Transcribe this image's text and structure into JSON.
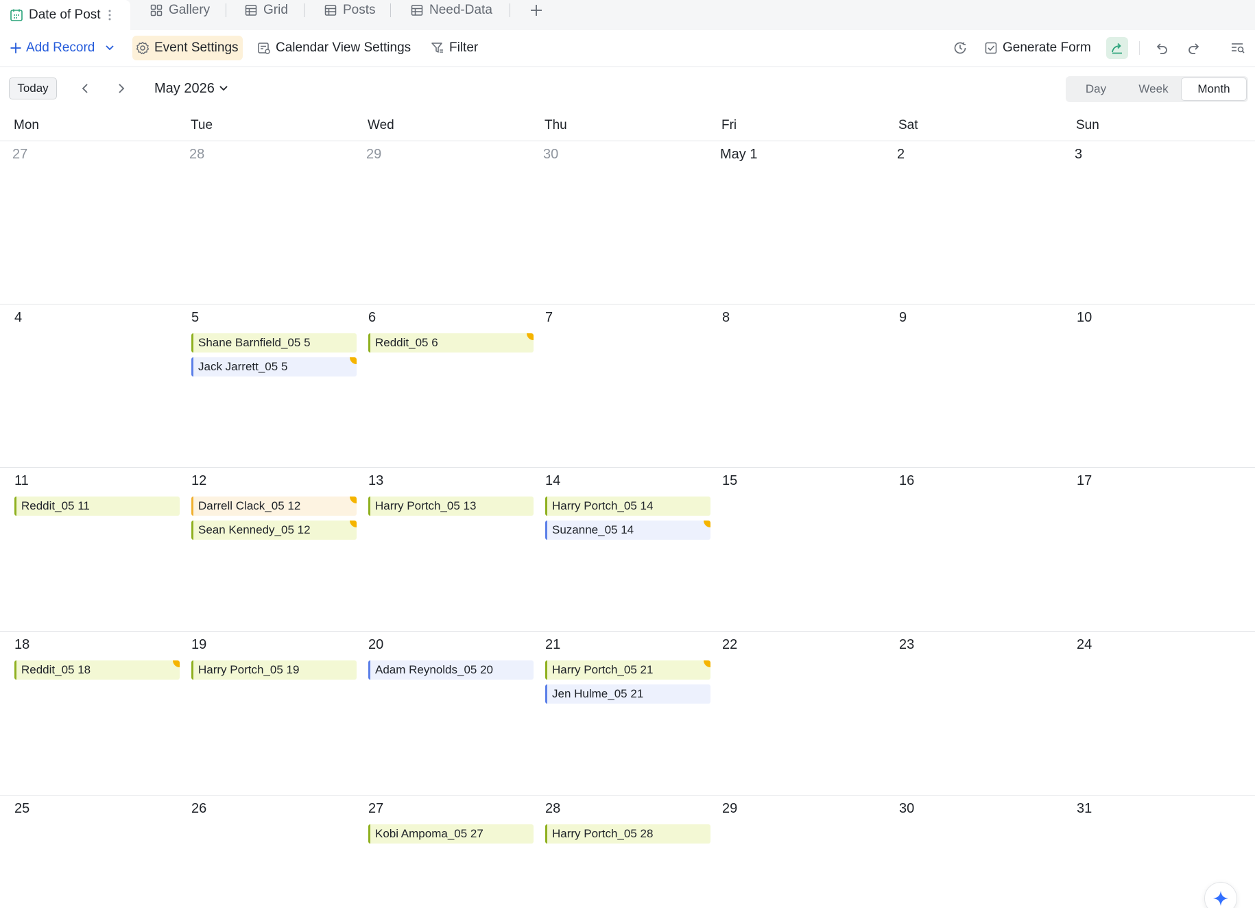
{
  "tabs": {
    "active": "Date of Post",
    "items": [
      "Gallery",
      "Grid",
      "Posts",
      "Need-Data"
    ]
  },
  "toolbar": {
    "add_record": "Add Record",
    "event_settings": "Event Settings",
    "calendar_view_settings": "Calendar View Settings",
    "filter": "Filter",
    "generate_form": "Generate Form"
  },
  "calendar": {
    "today": "Today",
    "month_label": "May 2026",
    "views": [
      "Day",
      "Week",
      "Month"
    ],
    "active_view": "Month",
    "weekdays": [
      "Mon",
      "Tue",
      "Wed",
      "Thu",
      "Fri",
      "Sat",
      "Sun"
    ],
    "weeks": [
      [
        "27",
        "28",
        "29",
        "30",
        "May 1",
        "2",
        "3"
      ],
      [
        "4",
        "5",
        "6",
        "7",
        "8",
        "9",
        "10"
      ],
      [
        "11",
        "12",
        "13",
        "14",
        "15",
        "16",
        "17"
      ],
      [
        "18",
        "19",
        "20",
        "21",
        "22",
        "23",
        "24"
      ],
      [
        "25",
        "26",
        "27",
        "28",
        "29",
        "30",
        "31"
      ]
    ],
    "events": [
      {
        "label": "Shane Barnfield_05 5",
        "week": 1,
        "day": 1,
        "slot": 0,
        "color": "green",
        "flag": false
      },
      {
        "label": "Jack Jarrett_05 5",
        "week": 1,
        "day": 1,
        "slot": 1,
        "color": "blue",
        "flag": true
      },
      {
        "label": "Reddit_05 6",
        "week": 1,
        "day": 2,
        "slot": 0,
        "color": "green",
        "flag": true
      },
      {
        "label": "Reddit_05 11",
        "week": 2,
        "day": 0,
        "slot": 0,
        "color": "green",
        "flag": false
      },
      {
        "label": "Darrell Clack_05 12",
        "week": 2,
        "day": 1,
        "slot": 0,
        "color": "orange",
        "flag": true
      },
      {
        "label": "Sean Kennedy_05 12",
        "week": 2,
        "day": 1,
        "slot": 1,
        "color": "green",
        "flag": true
      },
      {
        "label": "Harry Portch_05 13",
        "week": 2,
        "day": 2,
        "slot": 0,
        "color": "green",
        "flag": false
      },
      {
        "label": "Harry Portch_05 14",
        "week": 2,
        "day": 3,
        "slot": 0,
        "color": "green",
        "flag": false
      },
      {
        "label": "Suzanne_05 14",
        "week": 2,
        "day": 3,
        "slot": 1,
        "color": "blue",
        "flag": true
      },
      {
        "label": "Reddit_05 18",
        "week": 3,
        "day": 0,
        "slot": 0,
        "color": "green",
        "flag": true
      },
      {
        "label": "Harry Portch_05 19",
        "week": 3,
        "day": 1,
        "slot": 0,
        "color": "green",
        "flag": false
      },
      {
        "label": "Adam Reynolds_05 20",
        "week": 3,
        "day": 2,
        "slot": 0,
        "color": "blue",
        "flag": false
      },
      {
        "label": "Harry Portch_05 21",
        "week": 3,
        "day": 3,
        "slot": 0,
        "color": "green",
        "flag": true
      },
      {
        "label": "Jen Hulme_05 21",
        "week": 3,
        "day": 3,
        "slot": 1,
        "color": "blue",
        "flag": false
      },
      {
        "label": "Kobi Ampoma_05 27",
        "week": 4,
        "day": 2,
        "slot": 0,
        "color": "green",
        "flag": false
      },
      {
        "label": "Harry Portch_05 28",
        "week": 4,
        "day": 3,
        "slot": 0,
        "color": "green",
        "flag": false
      }
    ]
  },
  "icons": {
    "calendar_tab": "calendar-icon",
    "gallery": "gallery-grid-icon",
    "grid": "table-icon",
    "add_tab": "plus-icon",
    "history": "history-clock-icon",
    "share": "share-arrow-icon",
    "undo": "undo-icon",
    "redo": "redo-icon",
    "search": "search-list-icon",
    "ai": "sparkle-icon"
  },
  "colors": {
    "accent": "#245bdb",
    "event_green_bg": "#f3f8d4",
    "event_green_bar": "#8fb020",
    "event_blue_bg": "#edf1fd",
    "event_blue_bar": "#5b7fe8",
    "event_orange_bg": "#fdf3e1",
    "event_orange_bar": "#f0b030",
    "flag": "#f5b400"
  }
}
